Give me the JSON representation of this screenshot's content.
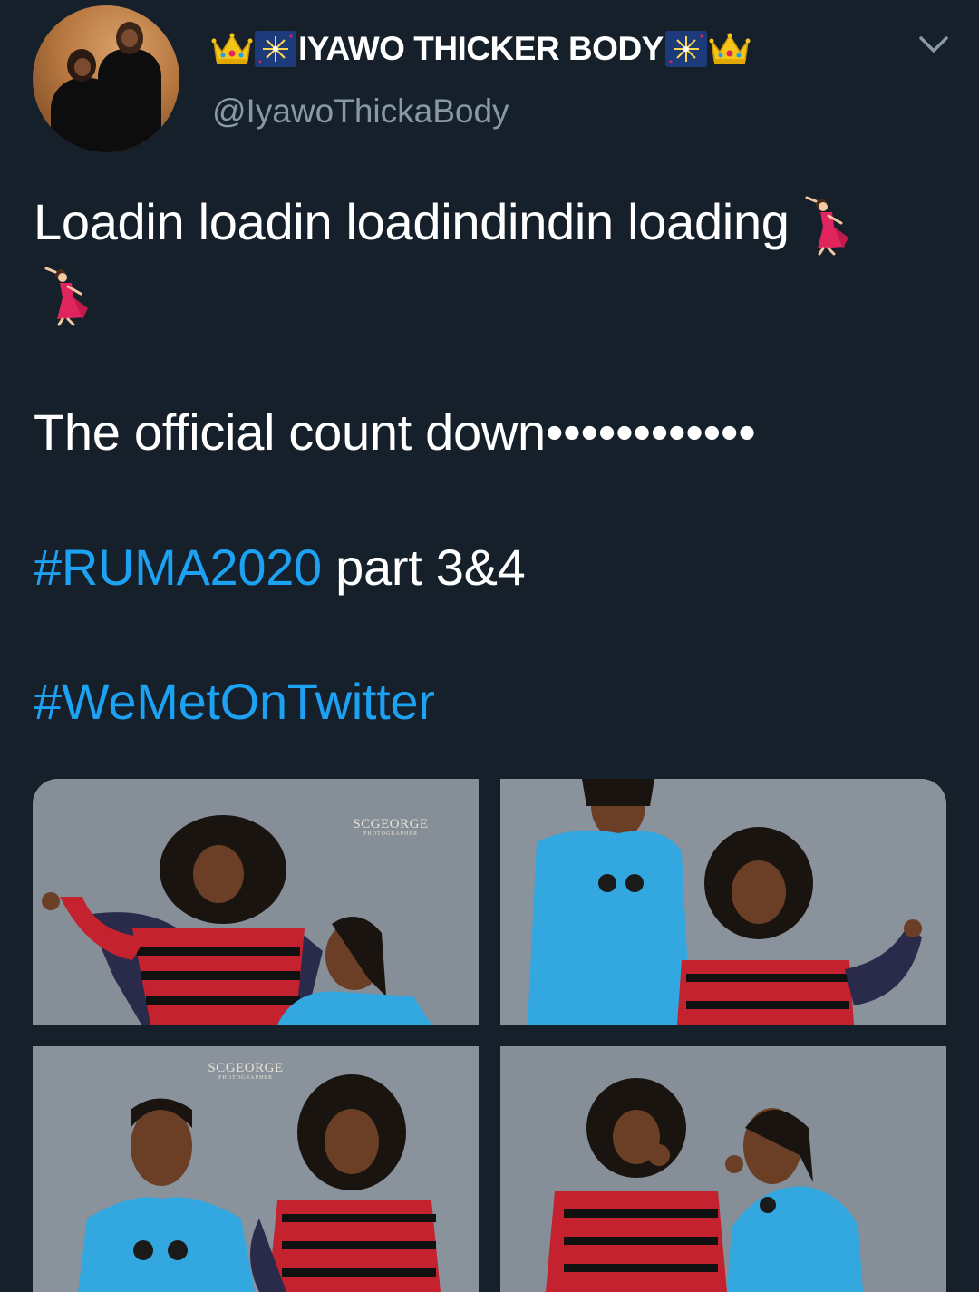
{
  "tweet": {
    "author": {
      "display_name": "IYAWO THICKER BODY",
      "handle": "@IyawoThickaBody",
      "avatar_icon": "couple-photo-avatar",
      "name_decorations": [
        "crown-icon",
        "fireworks-icon"
      ]
    },
    "menu_icon": "chevron-down-icon",
    "body": {
      "line1": "Loadin loadin loadindindin loading",
      "line1_emoji": "woman-dancing-icon",
      "line2_emoji": "woman-dancing-icon",
      "line3": "The official count down••••••••••••",
      "hashtag1": "#RUMA2020",
      "line4_rest": " part 3&4",
      "hashtag2": "#WeMetOnTwitter"
    },
    "media": {
      "photos": [
        {
          "name": "photo-1",
          "watermark": "SCGEORGE",
          "watermark_sub": "PHOTOGRAPHER"
        },
        {
          "name": "photo-2"
        },
        {
          "name": "photo-3",
          "watermark": "SCGEORGE",
          "watermark_sub": "PHOTOGRAPHER"
        },
        {
          "name": "photo-4"
        }
      ]
    }
  },
  "colors": {
    "background": "#15202b",
    "text": "#ffffff",
    "secondary_text": "#8899a6",
    "hashtag": "#1da1f2"
  }
}
